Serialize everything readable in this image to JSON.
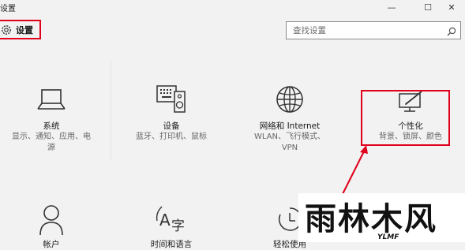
{
  "window": {
    "title": "设置",
    "minimize": "—",
    "maximize": "☐",
    "close": "✕"
  },
  "header": {
    "label": "设置"
  },
  "search": {
    "placeholder": "查找设置"
  },
  "tiles": [
    {
      "label": "系统",
      "desc1": "显示、通知、应用、电",
      "desc2": "源"
    },
    {
      "label": "设备",
      "desc1": "蓝牙、打印机、鼠标"
    },
    {
      "label": "网络和 Internet",
      "desc1": "WLAN、飞行模式、",
      "desc2": "VPN"
    },
    {
      "label": "个性化",
      "desc1": "背景、锁屏、颜色"
    },
    {
      "label": "帐户"
    },
    {
      "label": "时间和语言"
    },
    {
      "label": "轻松使用"
    }
  ],
  "icons": [
    "gear-icon",
    "search-icon",
    "laptop-icon",
    "keyboard-speaker-icon",
    "globe-icon",
    "personalization-icon",
    "person-icon",
    "time-language-icon",
    "ease-of-access-icon"
  ],
  "accent": "#e0001b",
  "watermark": {
    "text": "雨林木风",
    "subtext": "YLMF"
  }
}
